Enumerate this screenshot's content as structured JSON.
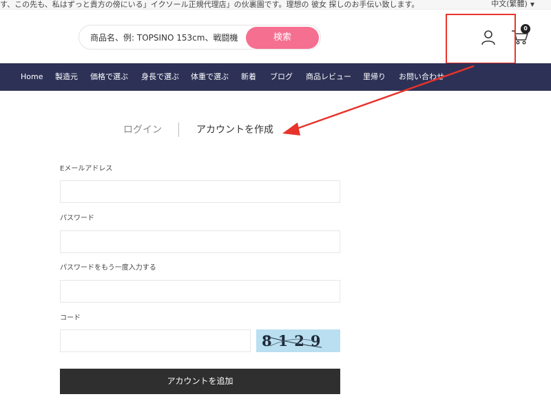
{
  "announcement": {
    "text": "す、この先も、私はずっと貴方の傍にいる」イクソール正規代理店」の伙裏園です。理想の 彼女 探しのお手伝い致します。",
    "language": "中文(繁體)"
  },
  "header": {
    "search_placeholder": "商品名、例: TOPSINO 153cm、戦闘機",
    "search_button": "検索",
    "cart_count": "0",
    "user_icon": "user-icon",
    "cart_icon": "cart-icon"
  },
  "nav": {
    "items": [
      {
        "label": "Home"
      },
      {
        "label": "製造元"
      },
      {
        "label": "価格で選ぶ"
      },
      {
        "label": "身長で選ぶ"
      },
      {
        "label": "体重で選ぶ"
      },
      {
        "label": "新着"
      },
      {
        "label": "ブログ"
      },
      {
        "label": "商品レビュー"
      },
      {
        "label": "里帰り"
      },
      {
        "label": "お問い合わせ"
      }
    ]
  },
  "tabs": {
    "login": "ログイン",
    "register": "アカウントを作成"
  },
  "form": {
    "email_label": "Eメールアドレス",
    "password_label": "パスワード",
    "password_confirm_label": "パスワードをもう一度入力する",
    "code_label": "コード",
    "captcha_text": "8129",
    "submit_label": "アカウントを追加"
  },
  "annotation": {
    "highlight_color": "#e8332b"
  }
}
